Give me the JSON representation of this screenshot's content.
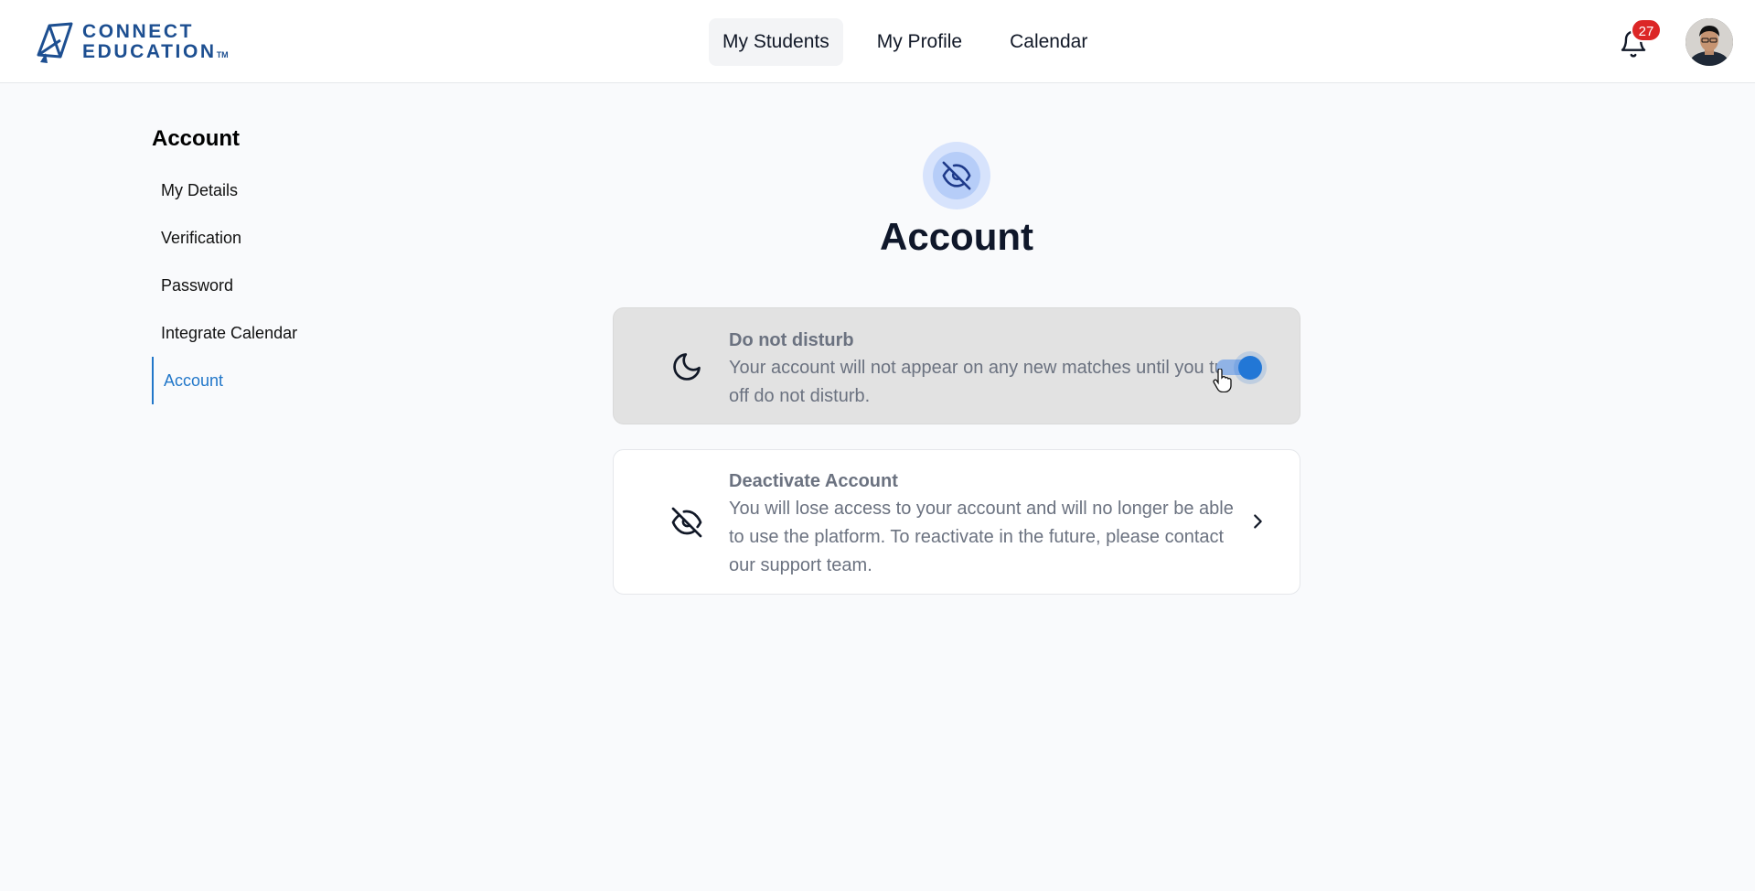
{
  "header": {
    "logo": {
      "line1": "CONNECT",
      "line2": "EDUCATION",
      "tm": "TM"
    },
    "nav": [
      {
        "label": "My Students",
        "active": true
      },
      {
        "label": "My Profile",
        "active": false
      },
      {
        "label": "Calendar",
        "active": false
      }
    ],
    "notifications_count": "27",
    "icons": {
      "bell": "bell-icon",
      "avatar": "user-avatar"
    }
  },
  "sidebar": {
    "title": "Account",
    "items": [
      {
        "label": "My Details",
        "active": false
      },
      {
        "label": "Verification",
        "active": false
      },
      {
        "label": "Password",
        "active": false
      },
      {
        "label": "Integrate Calendar",
        "active": false
      },
      {
        "label": "Account",
        "active": true
      }
    ]
  },
  "main": {
    "icon": "eye-off-icon",
    "title": "Account",
    "cards": [
      {
        "icon": "moon-icon",
        "title": "Do not disturb",
        "description": "Your account will not appear on any new matches until you turn off do not disturb.",
        "toggle_on": true
      },
      {
        "icon": "eye-off-icon",
        "title": "Deactivate Account",
        "description": "You will lose access to your account and will no longer be able to use the platform. To reactivate in the future, please contact our support team.",
        "action_icon": "chevron-right-icon"
      }
    ]
  },
  "colors": {
    "accent": "#2277c9",
    "brand": "#1d4f91",
    "badge": "#dc2626",
    "toggle": "#2277d6",
    "page_bg": "#f9fafc"
  }
}
